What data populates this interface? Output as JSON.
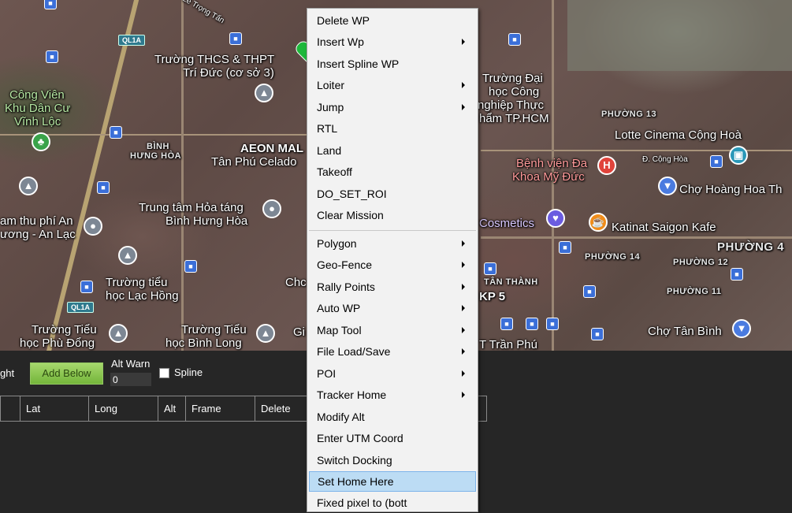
{
  "map": {
    "labels": {
      "truong_thcs": "Trường THCS & THPT",
      "tri_duc": "Trí Đức (cơ sở 3)",
      "cong_vien_1": "Công Viên",
      "cong_vien_2": "Khu Dân Cư",
      "cong_vien_3": "Vĩnh Lộc",
      "binh_hung_hoa_1": "BÌNH",
      "binh_hung_hoa_2": "HƯNG HÒA",
      "aeon_1": "AEON MAL",
      "aeon_2": "Tân Phú Celado",
      "trung_tam_1": "Trung tâm Hỏa táng",
      "trung_tam_2": "Bình Hưng Hòa",
      "tram_thu_phi_1": "am thu phí An",
      "tram_thu_phi_2": "ương - An Lạc",
      "truong_tieu_hoc_lh_1": "Trường tiểu",
      "truong_tieu_hoc_lh_2": "học Lạc Hồng",
      "truong_tieu_pd_1": "Trường Tiểu",
      "truong_tieu_pd_2": "học Phù Đổng",
      "truong_tieu_bl_1": "Trường Tiểu",
      "truong_tieu_bl_2": "học Bình Long",
      "truong_dai_hoc_1": "Trường Đại",
      "truong_dai_hoc_2": "học Công",
      "truong_dai_hoc_3": "nghiệp Thực",
      "truong_dai_hoc_4": "hẩm TP.HCM",
      "phuong_13": "PHƯỜNG 13",
      "lotte": "Lotte Cinema Cộng Hoà",
      "cong_hoa": "Đ. Cộng Hòa",
      "benh_vien_1": "Bệnh viện Đa",
      "benh_vien_2": "Khoa Mỹ Đức",
      "cho_hoang_hoa": "Chợ Hoàng Hoa Th",
      "cosmetics": "Cosmetics",
      "katinat": "Katinat Saigon Kafe",
      "phuong_4": "PHƯỜNG 4",
      "phuong_14": "PHƯỜNG 14",
      "phuong_12": "PHƯỜNG 12",
      "tan_thanh": "TÂN THÀNH",
      "kp5": "KP 5",
      "phuong_11": "PHƯỜNG 11",
      "cho_tan_binh": "Chợ Tân Bình",
      "tran_phu": "T Trần Phú",
      "le_trong_tan": "Lê Trọng Tấn",
      "chc": "Chc",
      "ql1a": "QL1A",
      "ql1a_2": "QL1A",
      "gi": "Gi"
    }
  },
  "panel": {
    "ght_label": "ght",
    "add_below": "Add Below",
    "alt_warn_label": "Alt Warn",
    "alt_warn_value": "0",
    "spline_label": "Spline",
    "columns": [
      "Lat",
      "Long",
      "Alt",
      "Frame",
      "Delete"
    ]
  },
  "context_menu": {
    "items": [
      {
        "label": "Delete WP",
        "submenu": false
      },
      {
        "label": "Insert Wp",
        "submenu": true
      },
      {
        "label": "Insert Spline WP",
        "submenu": false
      },
      {
        "label": "Loiter",
        "submenu": true
      },
      {
        "label": "Jump",
        "submenu": true
      },
      {
        "label": "RTL",
        "submenu": false
      },
      {
        "label": "Land",
        "submenu": false
      },
      {
        "label": "Takeoff",
        "submenu": false
      },
      {
        "label": "DO_SET_ROI",
        "submenu": false
      },
      {
        "label": "Clear Mission",
        "submenu": false
      },
      {
        "label": "Polygon",
        "submenu": true
      },
      {
        "label": "Geo-Fence",
        "submenu": true
      },
      {
        "label": "Rally Points",
        "submenu": true
      },
      {
        "label": "Auto WP",
        "submenu": true
      },
      {
        "label": "Map Tool",
        "submenu": true
      },
      {
        "label": "File Load/Save",
        "submenu": true
      },
      {
        "label": "POI",
        "submenu": true
      },
      {
        "label": "Tracker Home",
        "submenu": true
      },
      {
        "label": "Modify Alt",
        "submenu": false
      },
      {
        "label": "Enter UTM Coord",
        "submenu": false
      },
      {
        "label": "Switch Docking",
        "submenu": false
      },
      {
        "label": "Set Home Here",
        "submenu": false,
        "highlighted": true
      },
      {
        "label": "Fixed pixel to (bott",
        "submenu": false
      }
    ]
  },
  "colors": {
    "menu_bg": "#f2f2f2",
    "menu_highlight": "#bcdcf4",
    "add_below_green": "#8cc152",
    "panel_bg": "#262626"
  }
}
